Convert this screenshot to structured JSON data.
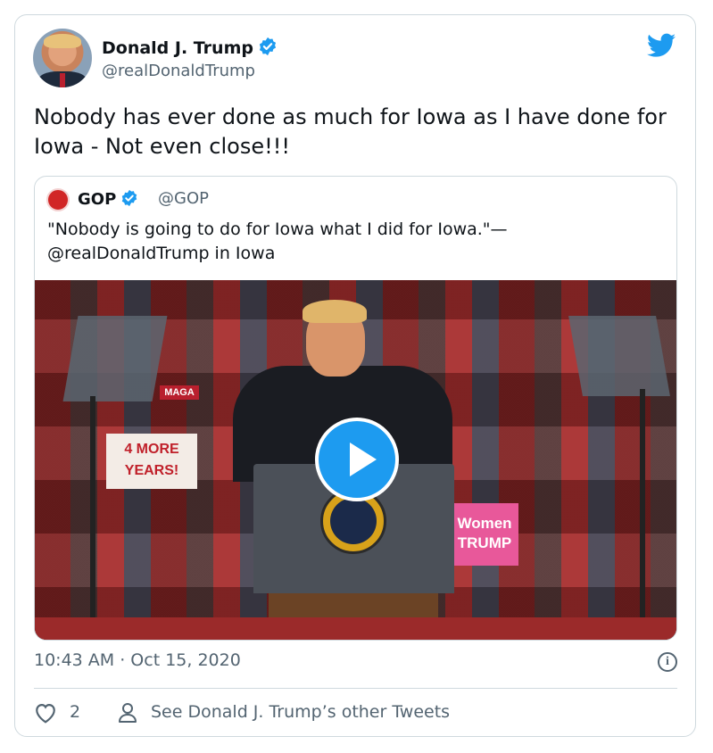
{
  "tweet": {
    "author_name": "Donald J. Trump",
    "author_handle": "@realDonaldTrump",
    "text": "Nobody has ever done as much for Iowa as I have done for Iowa - Not even close!!!",
    "timestamp": "10:43 AM · Oct 15, 2020",
    "like_count": "2",
    "other_tweets_label": "See Donald J. Trump’s other Tweets"
  },
  "quote": {
    "author_name": "GOP",
    "author_handle": "@GOP",
    "text": "\"Nobody is going to do for Iowa what I did for Iowa.\"—@realDonaldTrump in Iowa"
  },
  "media": {
    "signs": [
      "4 MORE YEARS!",
      "MAGA",
      "Women TRUMP"
    ]
  },
  "icons": {
    "verified": "verified-badge-icon",
    "twitter": "twitter-bird-icon",
    "info": "info-icon",
    "heart": "heart-icon",
    "person": "person-icon",
    "play": "play-icon"
  },
  "colors": {
    "accent": "#1d9bf0",
    "text": "#0f1419",
    "secondary": "#536471",
    "border": "#cfd9de",
    "gop_red": "#d12626"
  }
}
